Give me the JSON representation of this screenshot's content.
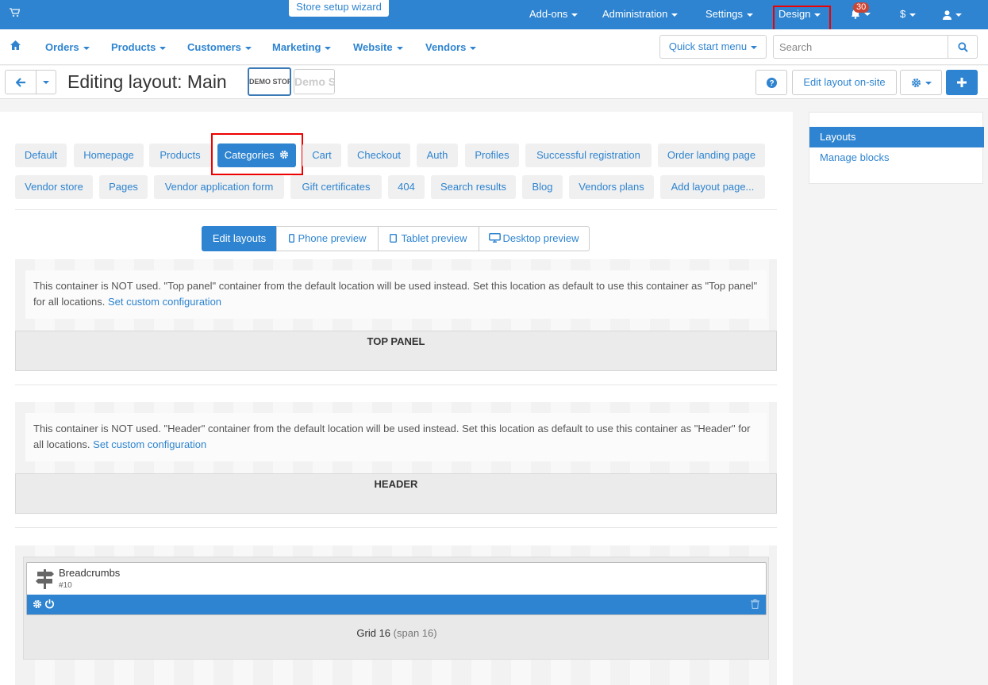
{
  "topbar": {
    "wizard": "Store setup wizard",
    "menu": [
      "Add-ons",
      "Administration",
      "Settings",
      "Design"
    ],
    "notifications_count": "30",
    "currency": "$"
  },
  "nav": {
    "items": [
      "Orders",
      "Products",
      "Customers",
      "Marketing",
      "Website",
      "Vendors"
    ],
    "quick_start": "Quick start menu",
    "search_placeholder": "Search"
  },
  "titlebar": {
    "title": "Editing layout: Main",
    "logo1": "DEMO STORE",
    "logo2": "Demo Store",
    "edit_onsite": "Edit layout on-site"
  },
  "tabs": {
    "row1": [
      "Default",
      "Homepage",
      "Products",
      "Categories",
      "Cart",
      "Checkout",
      "Auth",
      "Profiles",
      "Successful registration",
      "Order landing page"
    ],
    "row2": [
      "Vendor store",
      "Pages",
      "Vendor application form",
      "Gift certificates",
      "404",
      "Search results",
      "Blog",
      "Vendors plans",
      "Add layout page..."
    ]
  },
  "preview": [
    "Edit layouts",
    "Phone preview",
    "Tablet preview",
    "Desktop preview"
  ],
  "containers": {
    "top_panel": {
      "notice": "This container is NOT used. \"Top panel\" container from the default location will be used instead. Set this location as default to use this container as \"Top panel\" for all locations.",
      "link": "Set custom configuration",
      "label": "TOP PANEL"
    },
    "header": {
      "notice": "This container is NOT used. \"Header\" container from the default location will be used instead. Set this location as default to use this container as \"Header\" for all locations.",
      "link": "Set custom configuration",
      "label": "HEADER"
    }
  },
  "grid": {
    "block_title": "Breadcrumbs",
    "block_id": "#10",
    "label": "Grid 16",
    "span": "(span 16)"
  },
  "sidebar": {
    "items": [
      "Layouts",
      "Manage blocks"
    ]
  },
  "colors": {
    "primary": "#2e84d0",
    "highlight": "#ee0000"
  }
}
